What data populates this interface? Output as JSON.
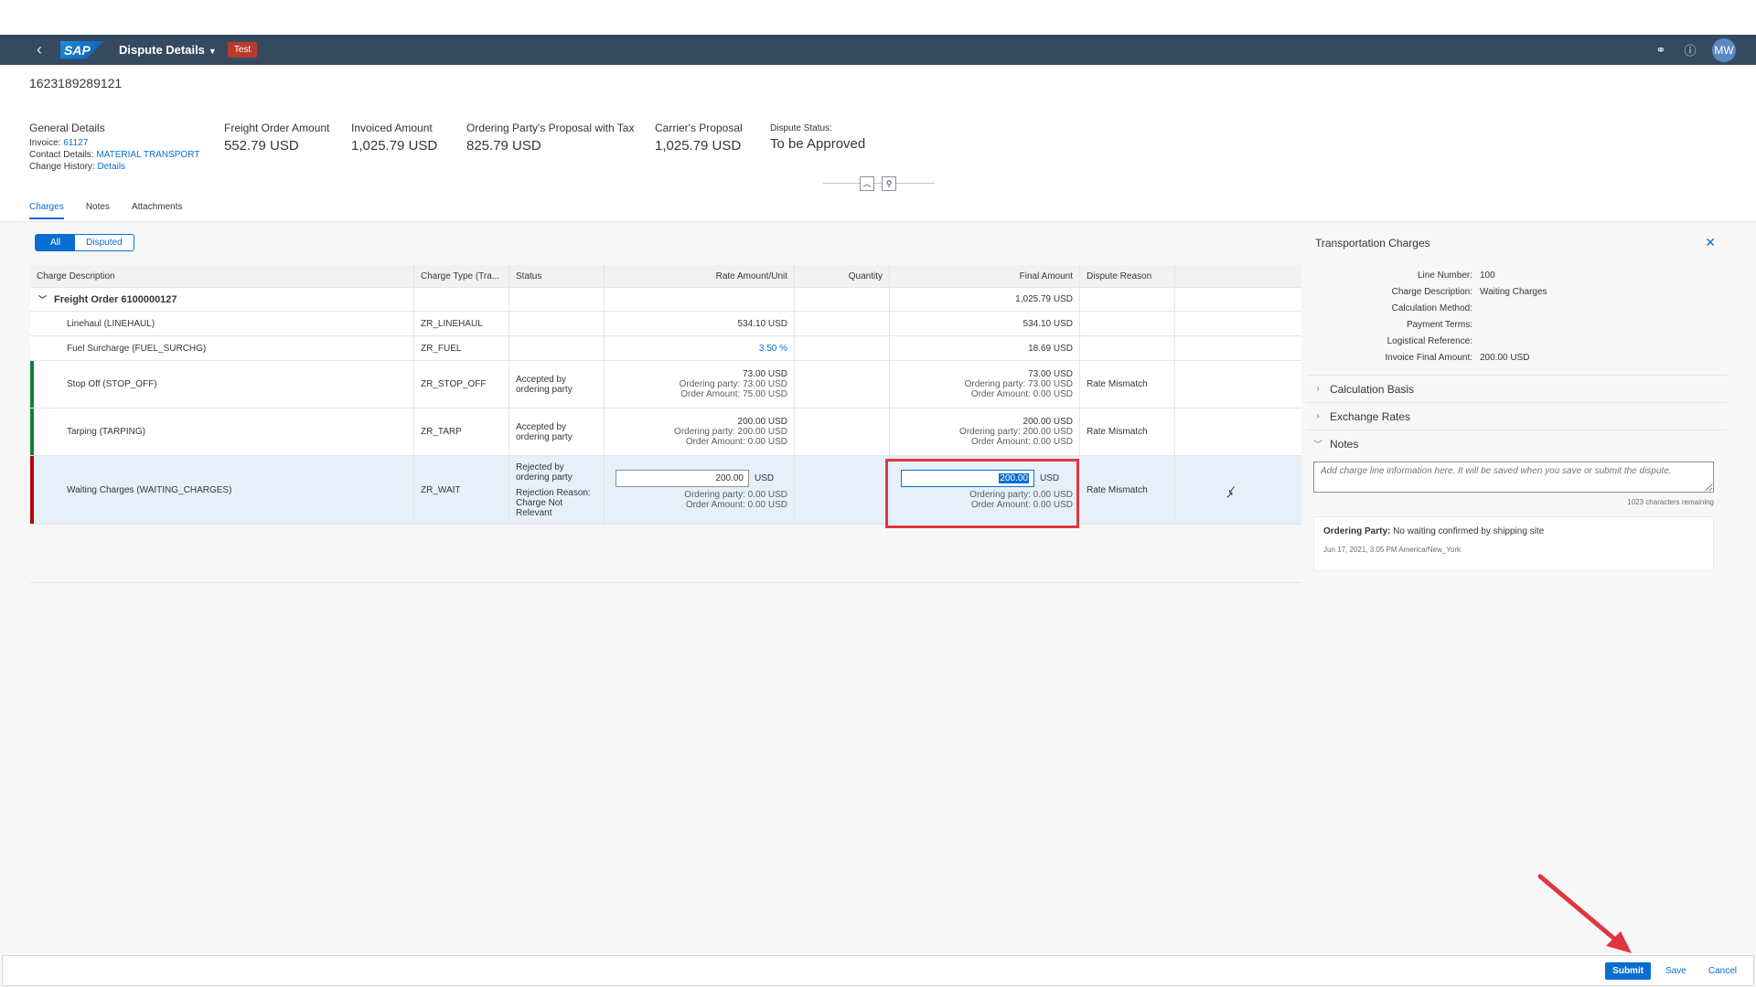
{
  "shell": {
    "logo": "SAP",
    "title": "Dispute Details",
    "badge": "Test",
    "avatar": "MW"
  },
  "header": {
    "doc_id": "1623189289121",
    "general": {
      "title": "General Details",
      "invoice_label": "Invoice:",
      "invoice_value": "61127",
      "contact_label": "Contact Details:",
      "contact_value": "MATERIAL TRANSPORT",
      "history_label": "Change History:",
      "history_value": "Details"
    },
    "kpis": [
      {
        "label": "Freight Order Amount",
        "value": "552.79 USD"
      },
      {
        "label": "Invoiced Amount",
        "value": "1,025.79 USD"
      },
      {
        "label": "Ordering Party's Proposal with Tax",
        "value": "825.79 USD"
      },
      {
        "label": "Carrier's Proposal",
        "value": "1,025.79 USD"
      }
    ],
    "status_label": "Dispute Status:",
    "status_value": "To be Approved",
    "tabs": [
      "Charges",
      "Notes",
      "Attachments"
    ]
  },
  "filter": {
    "all": "All",
    "disputed": "Disputed"
  },
  "table": {
    "columns": [
      "Charge Description",
      "Charge Type (Tra...",
      "Status",
      "Rate Amount/Unit",
      "Quantity",
      "Final Amount",
      "Dispute Reason"
    ],
    "group": {
      "label": "Freight Order 6100000127",
      "final": "1,025.79 USD"
    },
    "rows": [
      {
        "desc": "Linehaul (LINEHAUL)",
        "type": "ZR_LINEHAUL",
        "rate": "534.10 USD",
        "final": "534.10 USD"
      },
      {
        "desc": "Fuel Surcharge (FUEL_SURCHG)",
        "type": "ZR_FUEL",
        "rate": "3.50 %",
        "final": "18.69 USD"
      },
      {
        "desc": "Stop Off (STOP_OFF)",
        "type": "ZR_STOP_OFF",
        "status": "Accepted by ordering party",
        "rate": "73.00 USD",
        "rate_op": "Ordering party: 73.00 USD",
        "rate_oa": "Order Amount: 75.00 USD",
        "final": "73.00 USD",
        "final_op": "Ordering party: 73.00 USD",
        "final_oa": "Order Amount: 0.00 USD",
        "reason": "Rate Mismatch"
      },
      {
        "desc": "Tarping (TARPING)",
        "type": "ZR_TARP",
        "status": "Accepted by ordering party",
        "rate": "200.00 USD",
        "rate_op": "Ordering party: 200.00 USD",
        "rate_oa": "Order Amount: 0.00 USD",
        "final": "200.00 USD",
        "final_op": "Ordering party: 200.00 USD",
        "final_oa": "Order Amount: 0.00 USD",
        "reason": "Rate Mismatch"
      },
      {
        "desc": "Waiting Charges (WAITING_CHARGES)",
        "type": "ZR_WAIT",
        "status": "Rejected by ordering party",
        "rej_label": "Rejection Reason:",
        "rej_value": "Charge Not Relevant",
        "rate_input": "200.00",
        "rate_cur": "USD",
        "rate_op": "Ordering party: 0.00 USD",
        "rate_oa": "Order Amount: 0.00 USD",
        "final_input": "200.00",
        "final_cur": "USD",
        "final_op": "Ordering party: 0.00 USD",
        "final_oa": "Order Amount: 0.00 USD",
        "reason": "Rate Mismatch"
      }
    ]
  },
  "panel": {
    "title": "Transportation Charges",
    "fields": [
      {
        "k": "Line Number:",
        "v": "100"
      },
      {
        "k": "Charge Description:",
        "v": "Waiting Charges"
      },
      {
        "k": "Calculation Method:",
        "v": ""
      },
      {
        "k": "Payment Terms:",
        "v": ""
      },
      {
        "k": "Logistical Reference:",
        "v": ""
      },
      {
        "k": "Invoice Final Amount:",
        "v": "200.00 USD"
      }
    ],
    "sections": [
      "Calculation Basis",
      "Exchange Rates",
      "Notes"
    ],
    "notes_placeholder": "Add charge line information here. It will be saved when you save or submit the dispute.",
    "chars_remaining": "1023 characters remaining",
    "note_author": "Ordering Party:",
    "note_text": "No waiting confirmed by shipping site",
    "note_time": "Jun 17, 2021, 3:05 PM America/New_York"
  },
  "footer": {
    "submit": "Submit",
    "save": "Save",
    "cancel": "Cancel"
  },
  "colors": {
    "shell": "#354a5f",
    "accent": "#0a6ed1",
    "accepted": "#107e3e",
    "rejected": "#bb0000",
    "highlight": "#e0363f"
  }
}
